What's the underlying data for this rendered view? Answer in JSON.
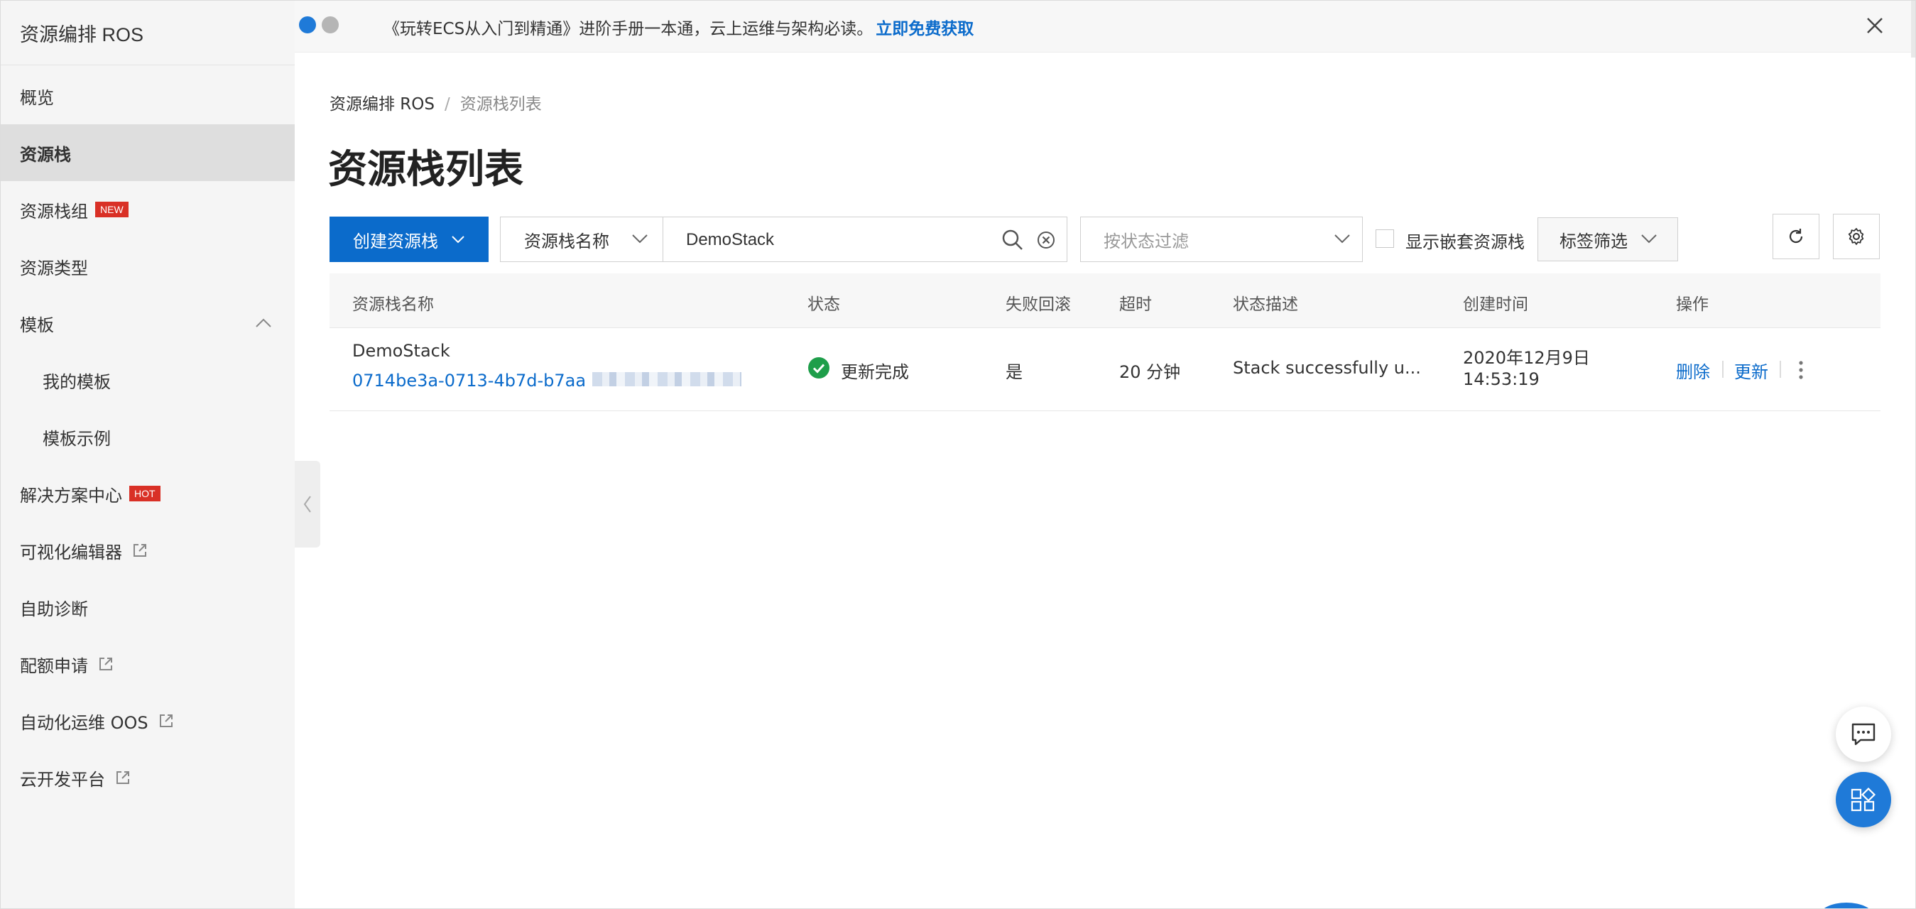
{
  "sidebar": {
    "title": "资源编排 ROS",
    "items": [
      {
        "label": "概览"
      },
      {
        "label": "资源栈",
        "active": true
      },
      {
        "label": "资源栈组",
        "badge": "NEW"
      },
      {
        "label": "资源类型"
      },
      {
        "label": "模板",
        "expanded": true
      },
      {
        "label": "我的模板"
      },
      {
        "label": "模板示例"
      },
      {
        "label": "解决方案中心",
        "badge": "HOT"
      },
      {
        "label": "可视化编辑器",
        "external": true
      },
      {
        "label": "自助诊断"
      },
      {
        "label": "配额申请",
        "external": true
      },
      {
        "label": "自动化运维 OOS",
        "external": true
      },
      {
        "label": "云开发平台",
        "external": true
      }
    ]
  },
  "banner": {
    "text": "《玩转ECS从入门到精通》进阶手册一本通，云上运维与架构必读。",
    "link": "立即免费获取"
  },
  "breadcrumb": {
    "root": "资源编排 ROS",
    "separator": "/",
    "current": "资源栈列表"
  },
  "page": {
    "title": "资源栈列表"
  },
  "toolbar": {
    "create_label": "创建资源栈",
    "search_field": "资源栈名称",
    "search_value": "DemoStack",
    "status_placeholder": "按状态过滤",
    "nested_label": "显示嵌套资源栈",
    "tag_filter": "标签筛选"
  },
  "table": {
    "columns": [
      "资源栈名称",
      "状态",
      "失败回滚",
      "超时",
      "状态描述",
      "创建时间",
      "操作"
    ],
    "rows": [
      {
        "name": "DemoStack",
        "id": "0714be3a-0713-4b7d-b7aa",
        "status": "更新完成",
        "rollback": "是",
        "timeout": "20 分钟",
        "description": "Stack successfully u...",
        "created_date": "2020年12月9日",
        "created_time": "14:53:19",
        "actions": [
          "删除",
          "更新"
        ]
      }
    ]
  },
  "colors": {
    "primary": "#0b6bcb",
    "success": "#1e9e4a",
    "badge": "#d93026",
    "dot_blue": "#1f7ad8",
    "dot_gray": "#b5b5b5"
  }
}
